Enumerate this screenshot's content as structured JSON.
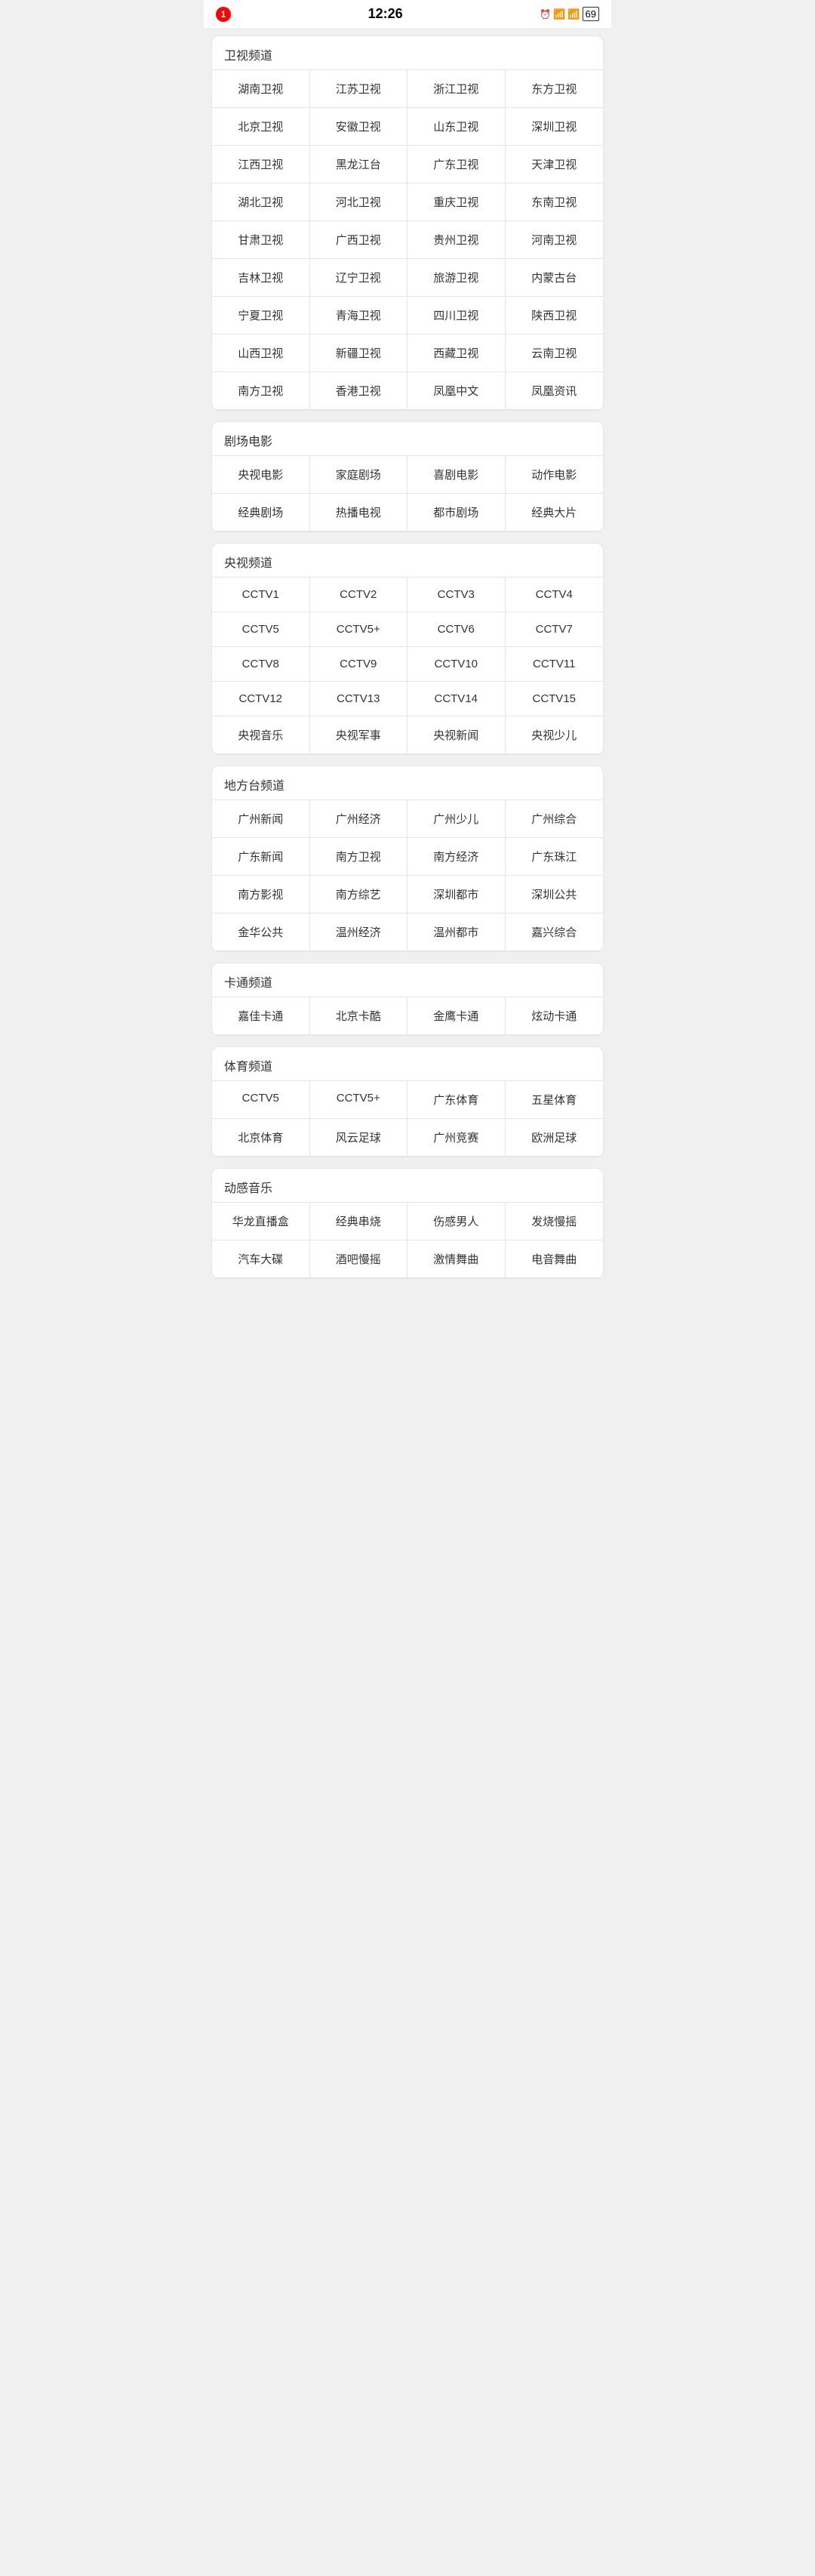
{
  "statusBar": {
    "time": "12:26",
    "notification": "1"
  },
  "sections": [
    {
      "id": "satellite",
      "title": "卫视频道",
      "items": [
        "湖南卫视",
        "江苏卫视",
        "浙江卫视",
        "东方卫视",
        "北京卫视",
        "安徽卫视",
        "山东卫视",
        "深圳卫视",
        "江西卫视",
        "黑龙江台",
        "广东卫视",
        "天津卫视",
        "湖北卫视",
        "河北卫视",
        "重庆卫视",
        "东南卫视",
        "甘肃卫视",
        "广西卫视",
        "贵州卫视",
        "河南卫视",
        "吉林卫视",
        "辽宁卫视",
        "旅游卫视",
        "内蒙古台",
        "宁夏卫视",
        "青海卫视",
        "四川卫视",
        "陕西卫视",
        "山西卫视",
        "新疆卫视",
        "西藏卫视",
        "云南卫视",
        "南方卫视",
        "香港卫视",
        "凤凰中文",
        "凤凰资讯"
      ]
    },
    {
      "id": "drama-movie",
      "title": "剧场电影",
      "items": [
        "央视电影",
        "家庭剧场",
        "喜剧电影",
        "动作电影",
        "经典剧场",
        "热播电视",
        "都市剧场",
        "经典大片"
      ]
    },
    {
      "id": "cctv",
      "title": "央视频道",
      "items": [
        "CCTV1",
        "CCTV2",
        "CCTV3",
        "CCTV4",
        "CCTV5",
        "CCTV5+",
        "CCTV6",
        "CCTV7",
        "CCTV8",
        "CCTV9",
        "CCTV10",
        "CCTV11",
        "CCTV12",
        "CCTV13",
        "CCTV14",
        "CCTV15",
        "央视音乐",
        "央视军事",
        "央视新闻",
        "央视少儿"
      ]
    },
    {
      "id": "local",
      "title": "地方台频道",
      "items": [
        "广州新闻",
        "广州经济",
        "广州少儿",
        "广州综合",
        "广东新闻",
        "南方卫视",
        "南方经济",
        "广东珠江",
        "南方影视",
        "南方综艺",
        "深圳都市",
        "深圳公共",
        "金华公共",
        "温州经济",
        "温州都市",
        "嘉兴综合"
      ]
    },
    {
      "id": "cartoon",
      "title": "卡通频道",
      "items": [
        "嘉佳卡通",
        "北京卡酷",
        "金鹰卡通",
        "炫动卡通"
      ]
    },
    {
      "id": "sports",
      "title": "体育频道",
      "items": [
        "CCTV5",
        "CCTV5+",
        "广东体育",
        "五星体育",
        "北京体育",
        "风云足球",
        "广州竞赛",
        "欧洲足球"
      ]
    },
    {
      "id": "music",
      "title": "动感音乐",
      "items": [
        "华龙直播盒",
        "经典串烧",
        "伤感男人",
        "发烧慢摇",
        "汽车大碟",
        "酒吧慢摇",
        "激情舞曲",
        "电音舞曲"
      ]
    }
  ]
}
